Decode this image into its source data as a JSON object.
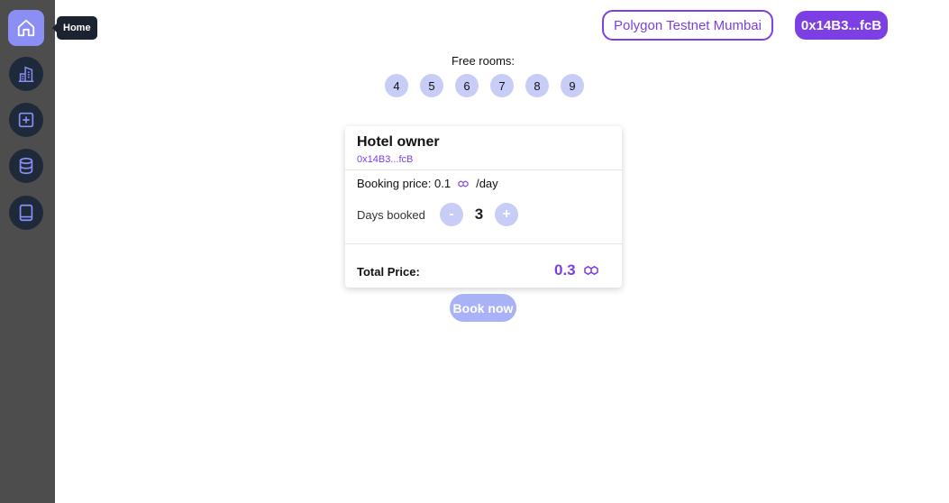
{
  "sidebar": {
    "items": [
      {
        "icon": "home-icon",
        "tooltip": "Home"
      },
      {
        "icon": "buildings-icon"
      },
      {
        "icon": "add-square-icon"
      },
      {
        "icon": "database-icon"
      },
      {
        "icon": "book-icon"
      }
    ],
    "tooltip": "Home"
  },
  "header": {
    "network": "Polygon Testnet Mumbai",
    "account": "0x14B3...fcB"
  },
  "rooms": {
    "label": "Free rooms:",
    "numbers": [
      "4",
      "5",
      "6",
      "7",
      "8",
      "9"
    ]
  },
  "card": {
    "title": "Hotel owner",
    "owner_address": "0x14B3...fcB",
    "price_label": "Booking price: 0.1",
    "price_unit": "/day",
    "days_label": "Days booked",
    "minus_label": "-",
    "plus_label": "+",
    "days_value": "3",
    "total_label": "Total Price:",
    "total_value": "0.3"
  },
  "book_button": "Book now",
  "colors": {
    "accent": "#7b3fe4",
    "sidebar_bg": "#4d4d4d",
    "active_nav": "#8b8ef5",
    "room_chip": "#c7cdf6",
    "book_button": "#a9b2f7"
  }
}
